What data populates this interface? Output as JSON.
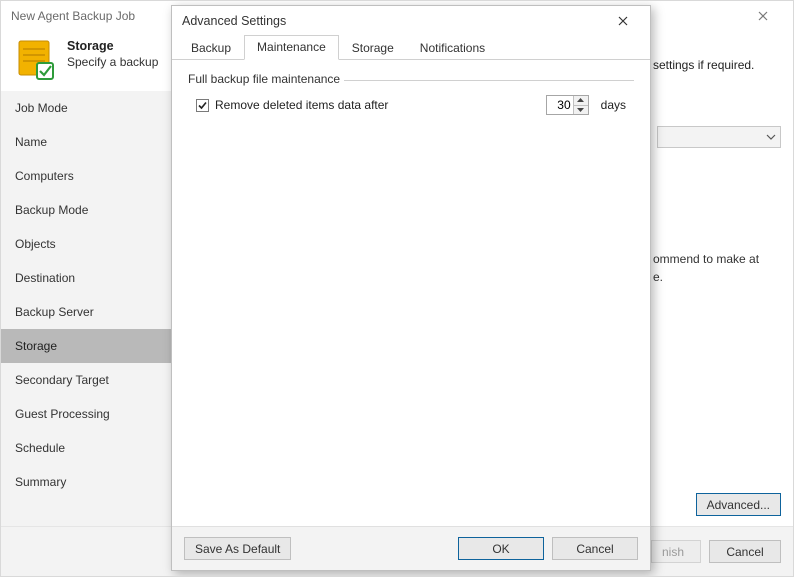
{
  "parent": {
    "title": "New Agent Backup Job",
    "header": {
      "title": "Storage",
      "desc_left": "Specify a backup",
      "desc_right": "settings if required."
    },
    "sidebar": {
      "items": [
        {
          "label": "Job Mode"
        },
        {
          "label": "Name"
        },
        {
          "label": "Computers"
        },
        {
          "label": "Backup Mode"
        },
        {
          "label": "Objects"
        },
        {
          "label": "Destination"
        },
        {
          "label": "Backup Server"
        },
        {
          "label": "Storage"
        },
        {
          "label": "Secondary Target"
        },
        {
          "label": "Guest Processing"
        },
        {
          "label": "Schedule"
        },
        {
          "label": "Summary"
        }
      ],
      "active_index": 7
    },
    "main": {
      "recommend_text": "ommend to make at\ne.",
      "advanced_btn": "Advanced..."
    },
    "footer": {
      "finish": "nish",
      "cancel": "Cancel"
    }
  },
  "modal": {
    "title": "Advanced Settings",
    "tabs": [
      "Backup",
      "Maintenance",
      "Storage",
      "Notifications"
    ],
    "active_tab": 1,
    "fieldset_legend": "Full backup file maintenance",
    "remove_label": "Remove deleted items data after",
    "remove_checked": true,
    "remove_value": "30",
    "days_label": "days",
    "buttons": {
      "save_default": "Save As Default",
      "ok": "OK",
      "cancel": "Cancel"
    }
  }
}
